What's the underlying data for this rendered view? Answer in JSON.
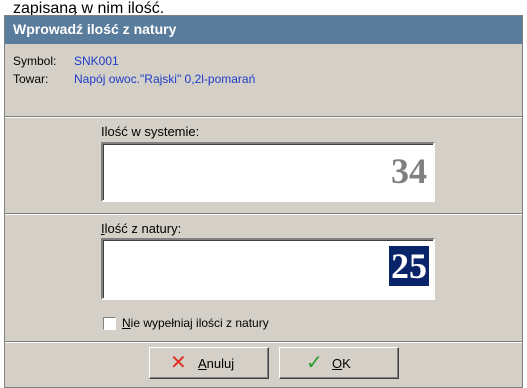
{
  "caption": "zapisaną w nim ilość.",
  "dialog": {
    "title": "Wprowadź ilość z natury",
    "symbol_label": "Symbol:",
    "symbol_value": "SNK001",
    "product_label": "Towar:",
    "product_value": "Napój owoc.\"Rajski\" 0,2l-pomarań",
    "system_qty_label": "Ilość w systemie:",
    "system_qty_value": "34",
    "natural_qty_label_first": "I",
    "natural_qty_label_rest": "lość z natury:",
    "natural_qty_value": "25",
    "checkbox_label_first": "N",
    "checkbox_label_rest": "ie wypełniaj ilości z natury",
    "checkbox_checked": false,
    "cancel_first": "A",
    "cancel_rest": "nuluj",
    "ok_first": "O",
    "ok_rest": "K"
  },
  "colors": {
    "title_bg": "#5a7c9c",
    "value_text": "#1e3cc8",
    "selection_bg": "#0a246a",
    "cancel_icon": "#e03020",
    "ok_icon": "#2a9a2a"
  }
}
